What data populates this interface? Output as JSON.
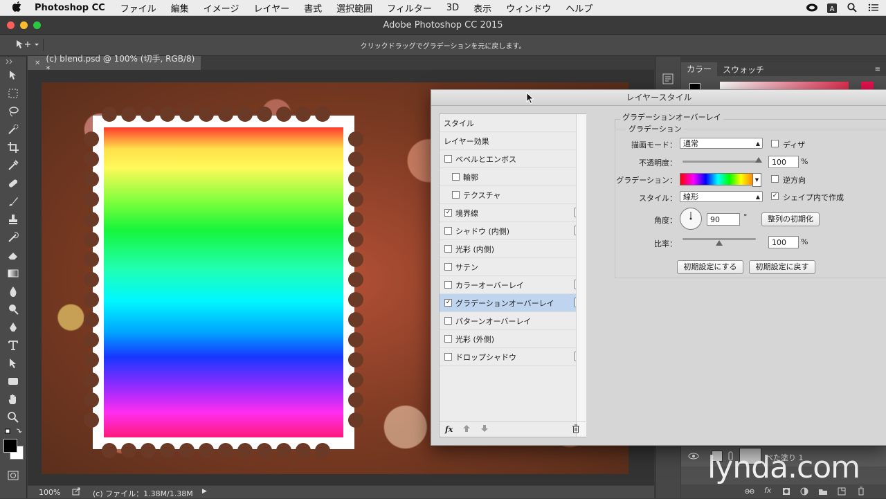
{
  "menubar": {
    "app": "Photoshop CC",
    "items": [
      "ファイル",
      "編集",
      "イメージ",
      "レイヤー",
      "書式",
      "選択範囲",
      "フィルター",
      "3D",
      "表示",
      "ウィンドウ",
      "ヘルプ"
    ]
  },
  "window": {
    "title": "Adobe Photoshop CC 2015"
  },
  "options_bar": {
    "hint": "クリックドラッグでグラデーションを元に戻します。"
  },
  "document": {
    "tab": "(c) blend.psd @ 100% (切手, RGB/8) *"
  },
  "status": {
    "zoom": "100%",
    "file_info": "(c) ファイル：1.38M/1.38M"
  },
  "right_panel": {
    "tabs": [
      "カラー",
      "スウォッチ"
    ],
    "layer_name": "べた塗り 1"
  },
  "watermark": "lynda.com",
  "dialog": {
    "title": "レイヤースタイル",
    "styles_header": "スタイル",
    "effects_header": "レイヤー効果",
    "effects": [
      {
        "label": "ベベルとエンボス",
        "checked": false,
        "sub": false,
        "plus": false
      },
      {
        "label": "輪郭",
        "checked": false,
        "sub": true,
        "plus": false
      },
      {
        "label": "テクスチャ",
        "checked": false,
        "sub": true,
        "plus": false
      },
      {
        "label": "境界線",
        "checked": true,
        "sub": false,
        "plus": true
      },
      {
        "label": "シャドウ (内側)",
        "checked": false,
        "sub": false,
        "plus": true
      },
      {
        "label": "光彩 (内側)",
        "checked": false,
        "sub": false,
        "plus": false
      },
      {
        "label": "サテン",
        "checked": false,
        "sub": false,
        "plus": false
      },
      {
        "label": "カラーオーバーレイ",
        "checked": false,
        "sub": false,
        "plus": true
      },
      {
        "label": "グラデーションオーバーレイ",
        "checked": true,
        "sub": false,
        "plus": true,
        "selected": true
      },
      {
        "label": "パターンオーバーレイ",
        "checked": false,
        "sub": false,
        "plus": false
      },
      {
        "label": "光彩 (外側)",
        "checked": false,
        "sub": false,
        "plus": false
      },
      {
        "label": "ドロップシャドウ",
        "checked": false,
        "sub": false,
        "plus": true
      }
    ],
    "section_title": "グラデーションオーバーレイ",
    "group_title": "グラデーション",
    "blend_mode_label": "描画モード：",
    "blend_mode_value": "通常",
    "dither_label": "ディザ",
    "dither_checked": false,
    "opacity_label": "不透明度：",
    "opacity_value": "100",
    "opacity_unit": "%",
    "gradient_label": "グラデーション：",
    "reverse_label": "逆方向",
    "reverse_checked": false,
    "style_label": "スタイル：",
    "style_value": "線形",
    "align_label": "シェイプ内で作成",
    "align_checked": true,
    "angle_label": "角度：",
    "angle_value": "90",
    "angle_unit": "°",
    "reset_align_button": "整列の初期化",
    "scale_label": "比率：",
    "scale_value": "100",
    "scale_unit": "%",
    "make_default_button": "初期設定にする",
    "reset_default_button": "初期設定に戻す",
    "opacity_level": 1.0,
    "scale_level": 0.5
  }
}
